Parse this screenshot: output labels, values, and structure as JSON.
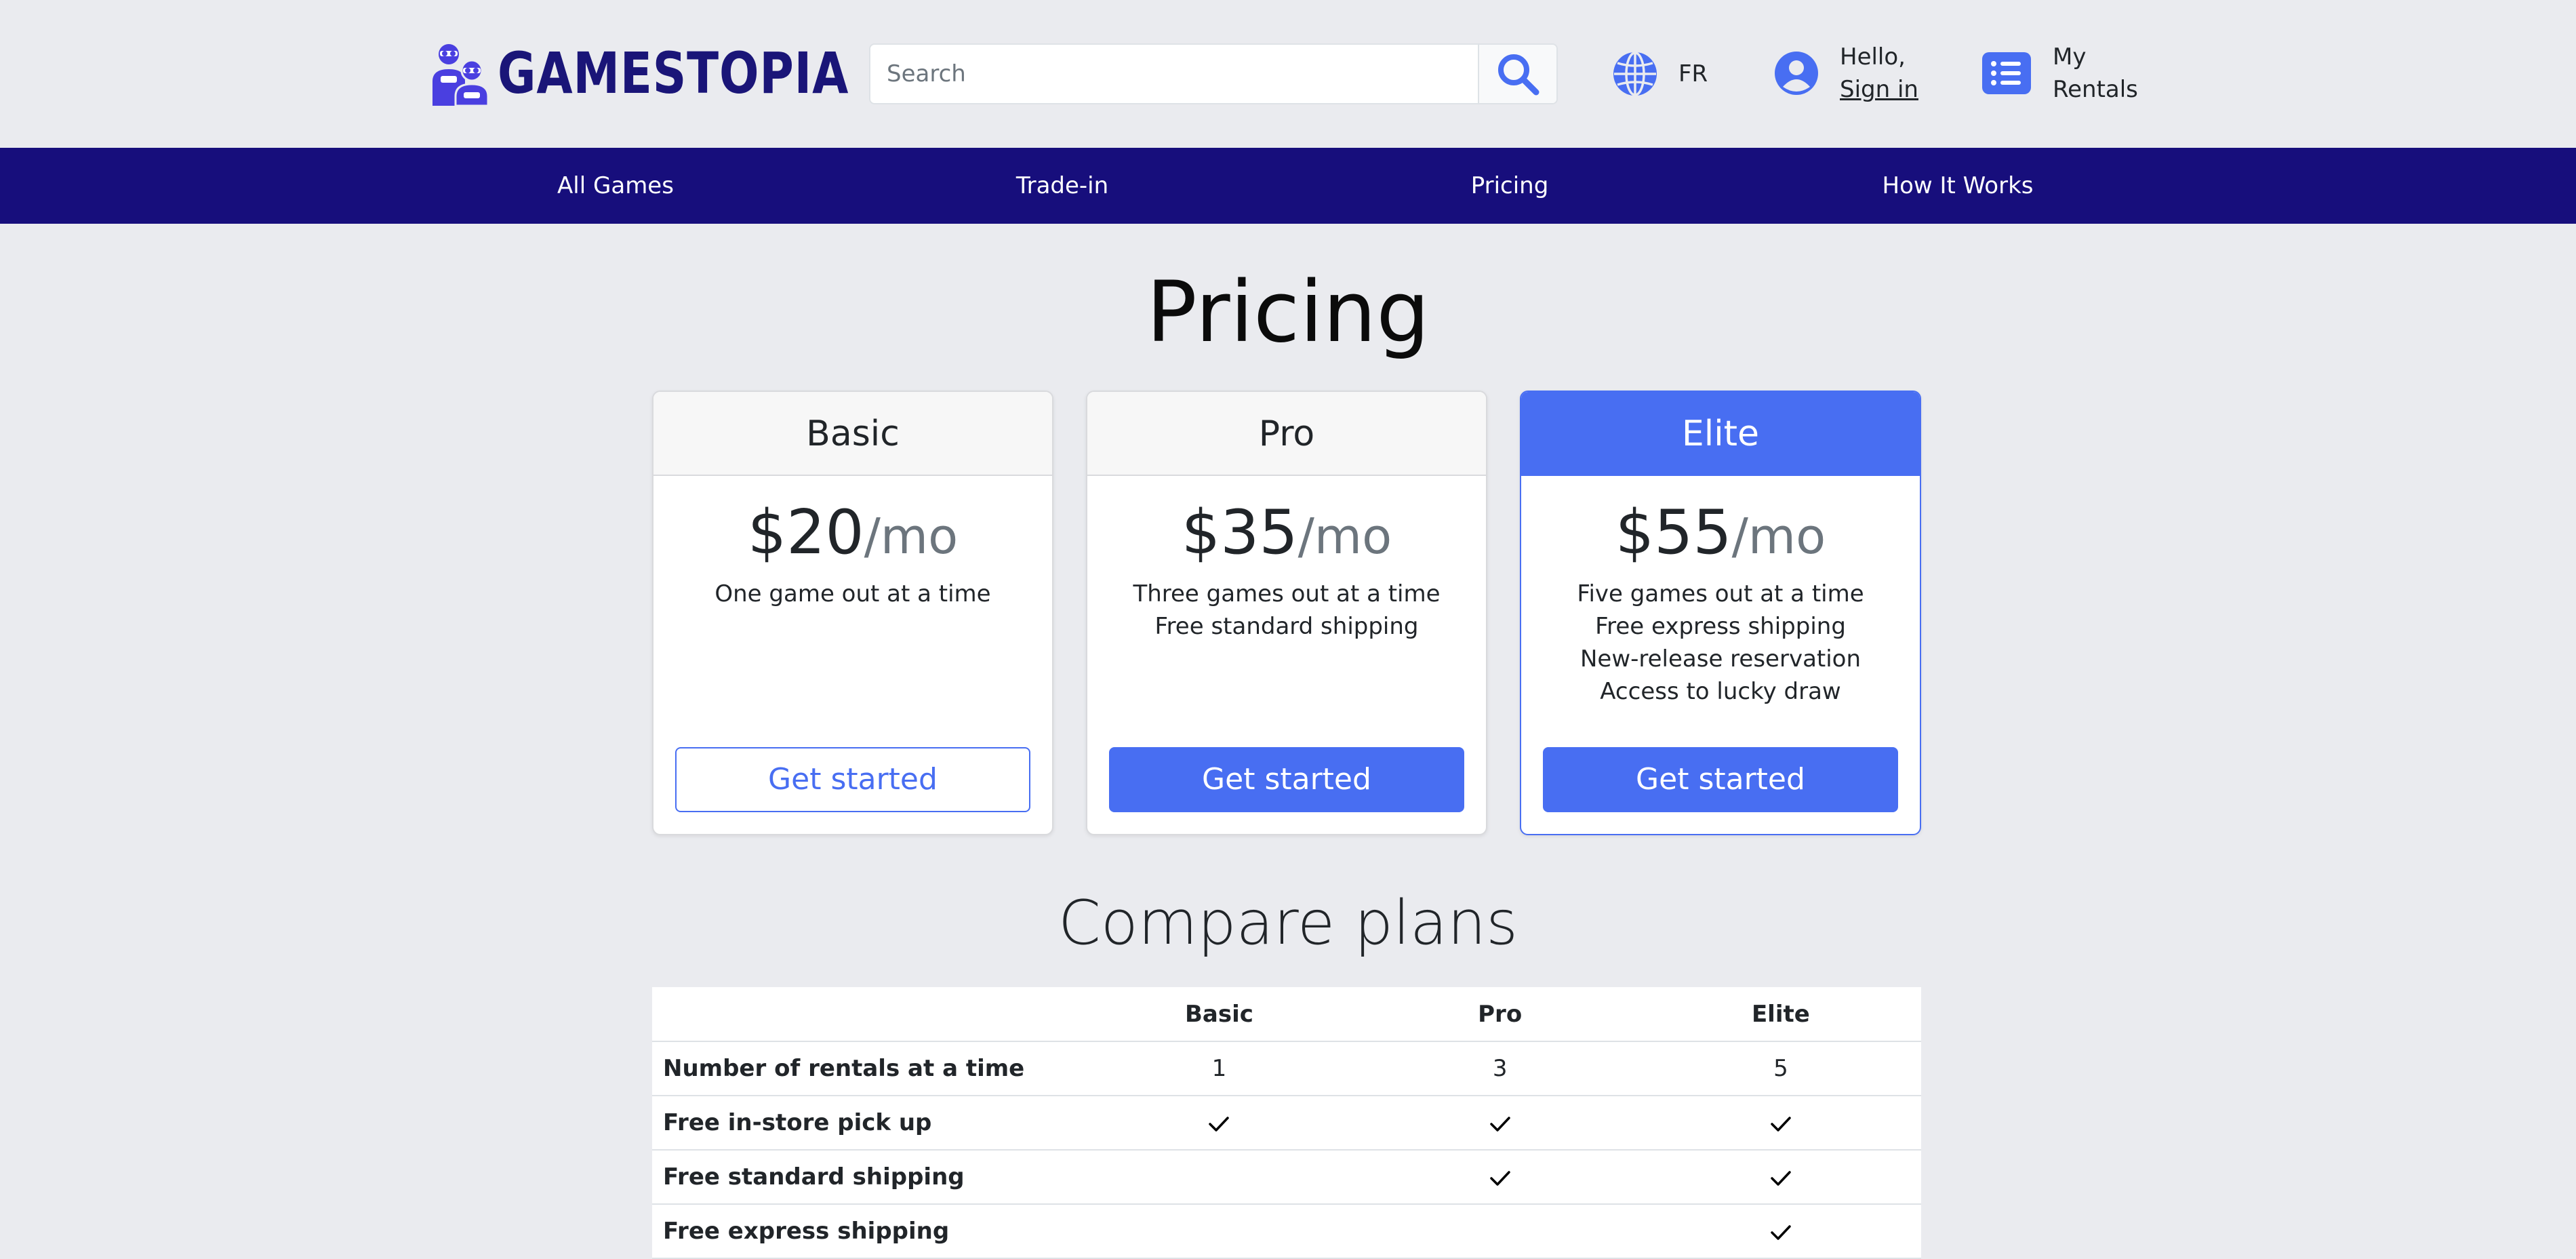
{
  "header": {
    "logo_text": "GAMESTOPIA",
    "search_placeholder": "Search",
    "language": "FR",
    "greeting": "Hello,",
    "sign_in": "Sign in",
    "rentals_line1": "My",
    "rentals_line2": "Rentals"
  },
  "nav": {
    "items": [
      "All Games",
      "Trade-in",
      "Pricing",
      "How It Works"
    ]
  },
  "pricing": {
    "title": "Pricing",
    "plans": [
      {
        "name": "Basic",
        "price": "$20",
        "period": "/mo",
        "features": [
          "One game out at a time"
        ],
        "cta": "Get started"
      },
      {
        "name": "Pro",
        "price": "$35",
        "period": "/mo",
        "features": [
          "Three games out at a time",
          "Free standard shipping"
        ],
        "cta": "Get started"
      },
      {
        "name": "Elite",
        "price": "$55",
        "period": "/mo",
        "features": [
          "Five games out at a time",
          "Free express shipping",
          "New-release reservation",
          "Access to lucky draw"
        ],
        "cta": "Get started"
      }
    ]
  },
  "compare": {
    "title": "Compare plans",
    "columns": [
      "",
      "Basic",
      "Pro",
      "Elite"
    ],
    "rows": [
      {
        "feature": "Number of rentals at a time",
        "basic": "1",
        "pro": "3",
        "elite": "5"
      },
      {
        "feature": "Free in-store pick up",
        "basic": "check",
        "pro": "check",
        "elite": "check"
      },
      {
        "feature": "Free standard shipping",
        "basic": "",
        "pro": "check",
        "elite": "check"
      },
      {
        "feature": "Free express shipping",
        "basic": "",
        "pro": "",
        "elite": "check"
      }
    ]
  },
  "colors": {
    "brand_navy": "#170e7c",
    "accent_blue": "#486ef2",
    "page_bg": "#eaebef"
  },
  "icons": {
    "search": "search-icon",
    "language": "globe-icon",
    "account": "user-circle-icon",
    "rentals": "list-icon",
    "check": "check-icon"
  }
}
